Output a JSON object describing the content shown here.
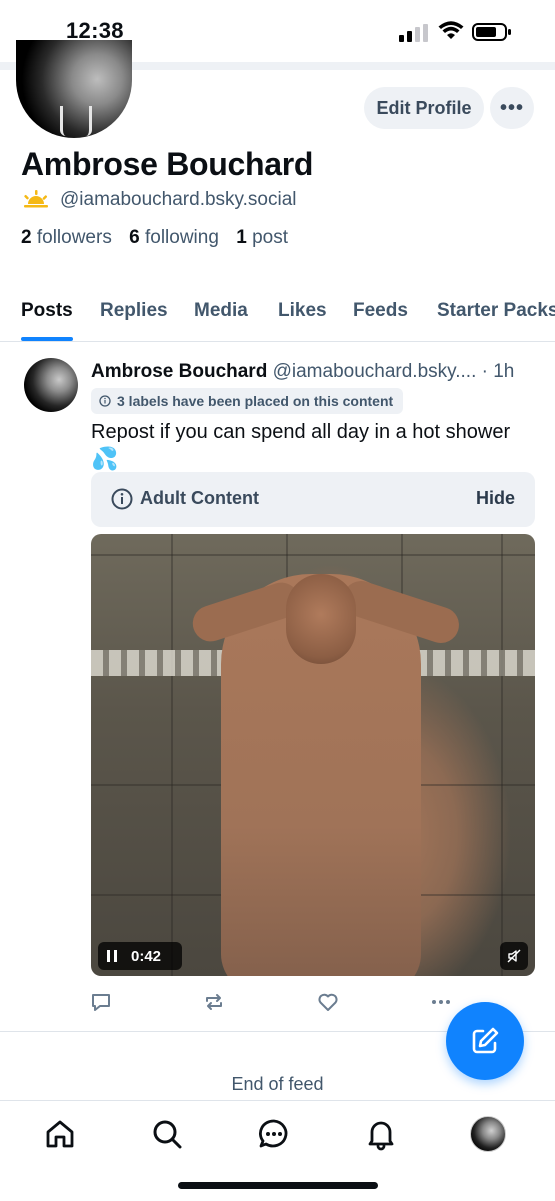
{
  "status_bar": {
    "time": "12:38"
  },
  "profile": {
    "name": "Ambrose Bouchard",
    "handle": "@iamabouchard.bsky.social",
    "followers_count": "2",
    "followers_label": "followers",
    "following_count": "6",
    "following_label": "following",
    "posts_count": "1",
    "posts_label": "post",
    "edit_label": "Edit Profile",
    "more_label": "•••"
  },
  "tabs": [
    {
      "label": "Posts",
      "active": true
    },
    {
      "label": "Replies"
    },
    {
      "label": "Media"
    },
    {
      "label": "Likes"
    },
    {
      "label": "Feeds"
    },
    {
      "label": "Starter Packs"
    }
  ],
  "post": {
    "author_name": "Ambrose Bouchard",
    "author_handle": "@iamabouchard.bsky....",
    "time": "· 1h",
    "labels_notice": "3 labels have been placed on this content",
    "text": "Repost if you can spend all day in a hot shower",
    "emoji": "💦",
    "content_warning": "Adult Content",
    "hide_label": "Hide",
    "video_time": "0:42"
  },
  "feed": {
    "end_label": "End of feed"
  },
  "colors": {
    "accent": "#1083fe",
    "muted": "#42576c",
    "surface": "#eef1f5"
  },
  "icons": [
    "home-icon",
    "search-icon",
    "chat-icon",
    "bell-icon",
    "compose-icon",
    "reply-icon",
    "repost-icon",
    "like-icon",
    "more-icon",
    "mute-icon",
    "info-icon"
  ]
}
